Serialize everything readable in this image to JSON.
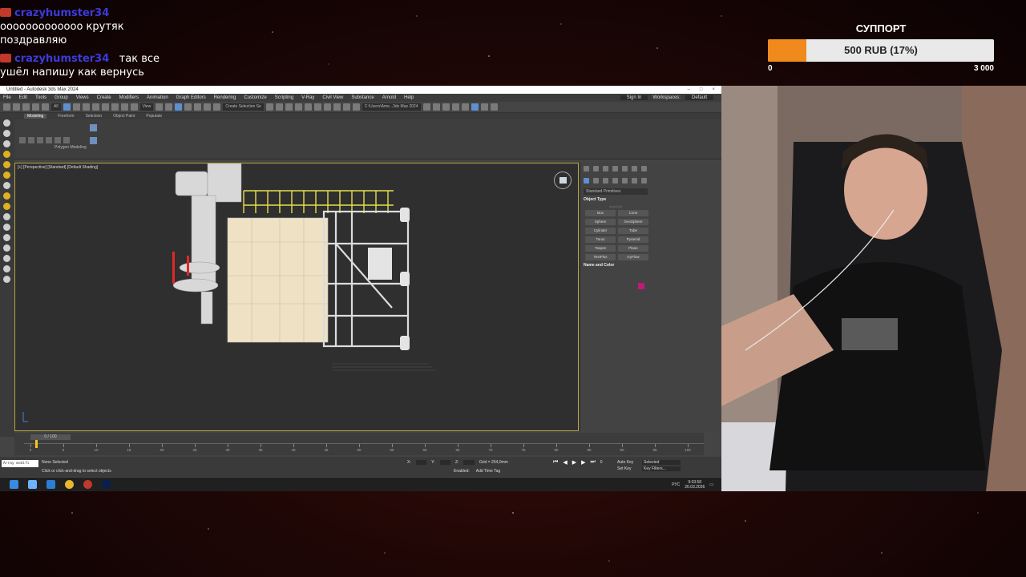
{
  "chat": {
    "messages": [
      {
        "user": "crazyhumster34",
        "text": "ооооооооооооо крутяк",
        "text2": "поздравляю"
      },
      {
        "user": "crazyhumster34",
        "text": "так все",
        "text2": "ушёл напишу как вернусь"
      }
    ]
  },
  "goal": {
    "title": "СУППОРТ",
    "label": "500 RUB (17%)",
    "progress_fraction": 0.17,
    "min": "0",
    "max": "3 000",
    "fill_color": "#f08a1c"
  },
  "app": {
    "title": "Untitled - Autodesk 3ds Max 2024",
    "menu": [
      "File",
      "Edit",
      "Tools",
      "Group",
      "Views",
      "Create",
      "Modifiers",
      "Animation",
      "Graph Editors",
      "Rendering",
      "Customize",
      "Scripting",
      "V-Ray",
      "Civil View",
      "Substance",
      "Arnold",
      "Help"
    ],
    "sign_in": "Sign In",
    "workspaces_label": "Workspaces:",
    "workspace_value": "Default",
    "toolbar_selection_set": "Create Selection Se",
    "toolbar_view": "View",
    "toolbar_all": "All",
    "path": "C:\\Users\\Ame...3ds Max 2024",
    "ribbon_tabs": [
      "Modeling",
      "Freeform",
      "Selection",
      "Object Paint",
      "Populate"
    ],
    "ribbon_group": "Polygon Modeling"
  },
  "viewport": {
    "label": "[+] [Perspective] [Standard] [Default Shading]"
  },
  "command_panel": {
    "category": "Standard Primitives",
    "object_type_title": "Object Type",
    "autogrid": "AutoGrid",
    "buttons": [
      "Box",
      "Cone",
      "Sphere",
      "GeoSphere",
      "Cylinder",
      "Tube",
      "Torus",
      "Pyramid",
      "Teapot",
      "Plane",
      "TextPlus",
      "IcyFlow"
    ],
    "name_color_title": "Name and Color",
    "swatch_color": "#c2187a"
  },
  "timeline": {
    "slider": "0 / 100",
    "ticks": [
      "0",
      "5",
      "10",
      "15",
      "20",
      "25",
      "30",
      "35",
      "40",
      "45",
      "50",
      "55",
      "60",
      "65",
      "70",
      "75",
      "80",
      "85",
      "90",
      "95",
      "100"
    ]
  },
  "status": {
    "script_listener": "Array modifi",
    "selection": "None Selected",
    "hint": "Click or click-and-drag to select objects",
    "x_label": "X:",
    "y_label": "Y:",
    "z_label": "Z:",
    "grid": "Grid = 254,0mm",
    "enabled": "Enabled:",
    "add_time_tag": "Add Time Tag",
    "frame": "0",
    "auto_key": "Auto Key",
    "selected": "Selected",
    "set_key": "Set Key",
    "key_filters": "Key Filters..."
  },
  "taskbar": {
    "lang": "РУС",
    "time": "9:03:58",
    "date": "26.03.2026"
  }
}
